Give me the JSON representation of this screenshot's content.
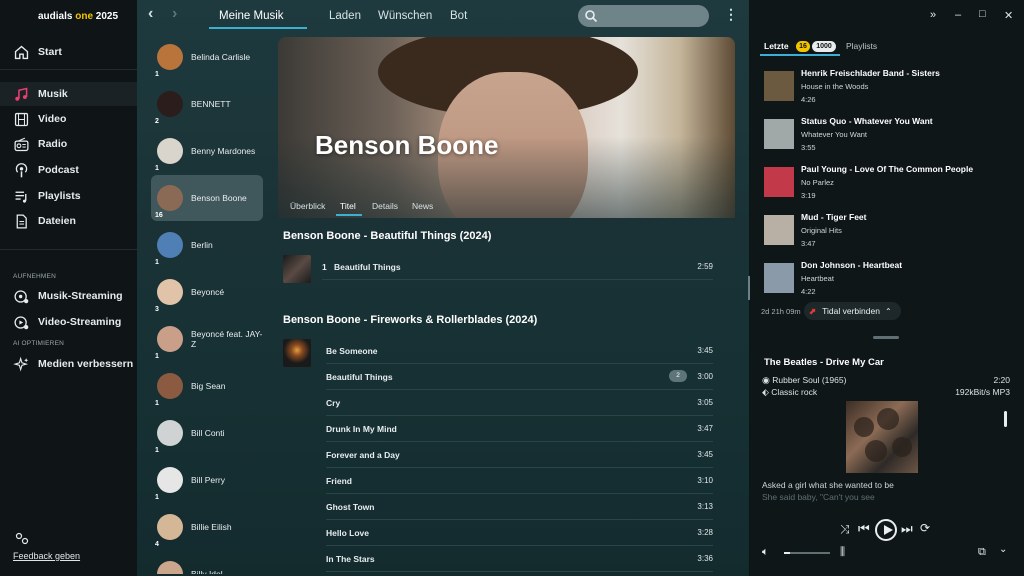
{
  "app": {
    "logo_prefix": "audials ",
    "logo_accent": "one",
    "logo_year": " 2025"
  },
  "nav": {
    "items": [
      {
        "label": "Start",
        "icon": "home-icon"
      },
      {
        "label": "Musik",
        "icon": "music-note-icon"
      },
      {
        "label": "Video",
        "icon": "film-icon"
      },
      {
        "label": "Radio",
        "icon": "radio-icon"
      },
      {
        "label": "Podcast",
        "icon": "podcast-icon"
      },
      {
        "label": "Playlists",
        "icon": "playlist-icon"
      },
      {
        "label": "Dateien",
        "icon": "files-icon"
      }
    ],
    "section_record": "AUFNEHMEN",
    "record_items": [
      {
        "label": "Musik-Streaming",
        "icon": "music-streaming-icon"
      },
      {
        "label": "Video-Streaming",
        "icon": "video-streaming-icon"
      }
    ],
    "section_ai": "AI OPTIMIEREN",
    "ai_items": [
      {
        "label": "Medien verbessern",
        "icon": "sparkle-icon"
      }
    ],
    "feedback": "Feedback geben"
  },
  "top_tabs": [
    "Meine Musik",
    "Laden",
    "Wünschen",
    "Bot"
  ],
  "artists": [
    {
      "name": "Belinda Carlisle",
      "count": "1",
      "color": "#b8743a"
    },
    {
      "name": "BENNETT",
      "count": "2",
      "color": "#2a1d1b"
    },
    {
      "name": "Benny Mardones",
      "count": "1",
      "color": "#d9d4cc"
    },
    {
      "name": "Benson Boone",
      "count": "16",
      "color": "#8a6a55"
    },
    {
      "name": "Berlin",
      "count": "1",
      "color": "#4f7fb5"
    },
    {
      "name": "Beyoncé",
      "count": "3",
      "color": "#e0c3a8"
    },
    {
      "name": "Beyoncé feat. JAY-Z",
      "count": "1",
      "color": "#c99f8a"
    },
    {
      "name": "Big Sean",
      "count": "1",
      "color": "#8b5a40"
    },
    {
      "name": "Bill Conti",
      "count": "1",
      "color": "#cfd3d4"
    },
    {
      "name": "Bill Perry",
      "count": "1",
      "color": "#e6e6e6"
    },
    {
      "name": "Billie Eilish",
      "count": "4",
      "color": "#d4b796"
    },
    {
      "name": "Billy Idol",
      "count": "",
      "color": "#cba58c"
    }
  ],
  "hero": {
    "name": "Benson Boone",
    "subtabs": [
      "Überblick",
      "Titel",
      "Details",
      "News"
    ]
  },
  "albums": [
    {
      "title": "Benson Boone - Beautiful Things  (2024)",
      "tracks": [
        {
          "num": "1",
          "title": "Beautiful Things",
          "duration": "2:59"
        }
      ]
    },
    {
      "title": "Benson Boone - Fireworks & Rollerblades  (2024)",
      "tracks": [
        {
          "title": "Be Someone",
          "duration": "3:45"
        },
        {
          "title": "Beautiful Things",
          "duration": "3:00",
          "badge": "2"
        },
        {
          "title": "Cry",
          "duration": "3:05"
        },
        {
          "title": "Drunk In My Mind",
          "duration": "3:47"
        },
        {
          "title": "Forever and a Day",
          "duration": "3:45"
        },
        {
          "title": "Friend",
          "duration": "3:10"
        },
        {
          "title": "Ghost Town",
          "duration": "3:13"
        },
        {
          "title": "Hello Love",
          "duration": "3:28"
        },
        {
          "title": "In The Stars",
          "duration": "3:36"
        }
      ]
    }
  ],
  "right": {
    "tab_recent": "Letzte",
    "badge_new": "16",
    "badge_total": "1000",
    "tab_playlists": "Playlists",
    "recent": [
      {
        "title": "Henrik Freischlader Band - Sisters",
        "album": "House in the Woods",
        "duration": "4:26",
        "color": "#6b5a40"
      },
      {
        "title": "Status Quo - Whatever You Want",
        "album": "Whatever You Want",
        "duration": "3:55",
        "color": "#a0a8a8"
      },
      {
        "title": "Paul Young - Love Of The Common People",
        "album": "No Parlez",
        "duration": "3:19",
        "color": "#c23a4a"
      },
      {
        "title": "Mud - Tiger Feet",
        "album": "Original Hits",
        "duration": "3:47",
        "color": "#b8b0a4"
      },
      {
        "title": "Don Johnson - Heartbeat",
        "album": "Heartbeat",
        "duration": "4:22",
        "color": "#8a9aa8"
      }
    ],
    "recent_time": "2d 21h 09m",
    "tidal_label": "Tidal verbinden"
  },
  "player": {
    "title": "The Beatles -  Drive My Car",
    "album": "Rubber Soul  (1965)",
    "genre": "Classic rock",
    "position": "2:20",
    "format": "192kBit/s MP3",
    "lyrics_1": "Asked a girl what she wanted to be",
    "lyrics_2": "She said baby, \"Can't you see"
  }
}
